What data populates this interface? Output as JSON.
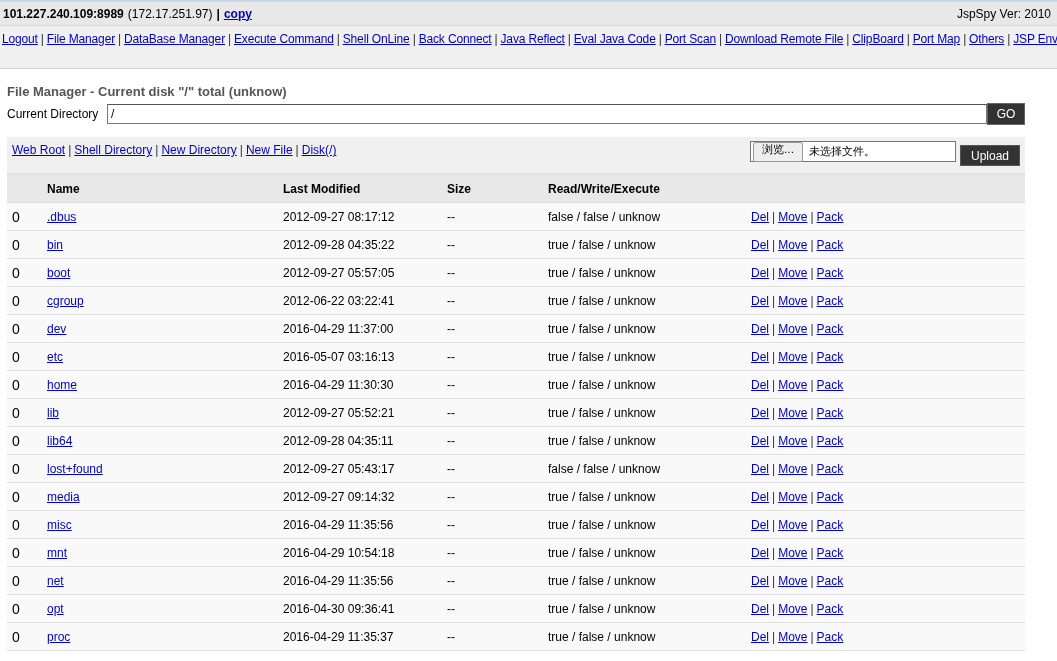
{
  "header": {
    "address": "101.227.240.109:8989",
    "internal_ip": "(172.17.251.97)",
    "separator": "|",
    "copy_link": "copy",
    "version": "JspSpy Ver: 2010"
  },
  "nav": {
    "separator": "|",
    "links": [
      "Logout",
      "File Manager",
      "DataBase Manager",
      "Execute Command",
      "Shell OnLine",
      "Back Connect",
      "Java Reflect",
      "Eval Java Code",
      "Port Scan",
      "Download Remote File",
      "ClipBoard",
      "Port Map",
      "Others",
      "JSP Env"
    ]
  },
  "title": "File Manager - Current disk \"/\" total (unknow)",
  "current_directory": {
    "label": "Current Directory",
    "value": "/",
    "button": "GO"
  },
  "toolbar": {
    "separator": "|",
    "links": [
      "Web Root",
      "Shell Directory",
      "New Directory",
      "New File",
      "Disk(/)"
    ]
  },
  "upload": {
    "browse_button": "浏览...",
    "file_status": "未选择文件。",
    "button": "Upload"
  },
  "table": {
    "columns": [
      "Name",
      "Last Modified",
      "Size",
      "Read/Write/Execute"
    ],
    "action_separator": "|",
    "rows": [
      {
        "index": "0",
        "name": ".dbus",
        "modified": "2012-09-27 08:17:12",
        "size": "--",
        "permissions": "false / false / unknow",
        "actions": [
          "Del",
          "Move",
          "Pack"
        ]
      },
      {
        "index": "0",
        "name": "bin",
        "modified": "2012-09-28 04:35:22",
        "size": "--",
        "permissions": "true / false / unknow",
        "actions": [
          "Del",
          "Move",
          "Pack"
        ]
      },
      {
        "index": "0",
        "name": "boot",
        "modified": "2012-09-27 05:57:05",
        "size": "--",
        "permissions": "true / false / unknow",
        "actions": [
          "Del",
          "Move",
          "Pack"
        ]
      },
      {
        "index": "0",
        "name": "cgroup",
        "modified": "2012-06-22 03:22:41",
        "size": "--",
        "permissions": "true / false / unknow",
        "actions": [
          "Del",
          "Move",
          "Pack"
        ]
      },
      {
        "index": "0",
        "name": "dev",
        "modified": "2016-04-29 11:37:00",
        "size": "--",
        "permissions": "true / false / unknow",
        "actions": [
          "Del",
          "Move",
          "Pack"
        ]
      },
      {
        "index": "0",
        "name": "etc",
        "modified": "2016-05-07 03:16:13",
        "size": "--",
        "permissions": "true / false / unknow",
        "actions": [
          "Del",
          "Move",
          "Pack"
        ]
      },
      {
        "index": "0",
        "name": "home",
        "modified": "2016-04-29 11:30:30",
        "size": "--",
        "permissions": "true / false / unknow",
        "actions": [
          "Del",
          "Move",
          "Pack"
        ]
      },
      {
        "index": "0",
        "name": "lib",
        "modified": "2012-09-27 05:52:21",
        "size": "--",
        "permissions": "true / false / unknow",
        "actions": [
          "Del",
          "Move",
          "Pack"
        ]
      },
      {
        "index": "0",
        "name": "lib64",
        "modified": "2012-09-28 04:35:11",
        "size": "--",
        "permissions": "true / false / unknow",
        "actions": [
          "Del",
          "Move",
          "Pack"
        ]
      },
      {
        "index": "0",
        "name": "lost+found",
        "modified": "2012-09-27 05:43:17",
        "size": "--",
        "permissions": "false / false / unknow",
        "actions": [
          "Del",
          "Move",
          "Pack"
        ]
      },
      {
        "index": "0",
        "name": "media",
        "modified": "2012-09-27 09:14:32",
        "size": "--",
        "permissions": "true / false / unknow",
        "actions": [
          "Del",
          "Move",
          "Pack"
        ]
      },
      {
        "index": "0",
        "name": "misc",
        "modified": "2016-04-29 11:35:56",
        "size": "--",
        "permissions": "true / false / unknow",
        "actions": [
          "Del",
          "Move",
          "Pack"
        ]
      },
      {
        "index": "0",
        "name": "mnt",
        "modified": "2016-04-29 10:54:18",
        "size": "--",
        "permissions": "true / false / unknow",
        "actions": [
          "Del",
          "Move",
          "Pack"
        ]
      },
      {
        "index": "0",
        "name": "net",
        "modified": "2016-04-29 11:35:56",
        "size": "--",
        "permissions": "true / false / unknow",
        "actions": [
          "Del",
          "Move",
          "Pack"
        ]
      },
      {
        "index": "0",
        "name": "opt",
        "modified": "2016-04-30 09:36:41",
        "size": "--",
        "permissions": "true / false / unknow",
        "actions": [
          "Del",
          "Move",
          "Pack"
        ]
      },
      {
        "index": "0",
        "name": "proc",
        "modified": "2016-04-29 11:35:37",
        "size": "--",
        "permissions": "true / false / unknow",
        "actions": [
          "Del",
          "Move",
          "Pack"
        ]
      }
    ]
  }
}
